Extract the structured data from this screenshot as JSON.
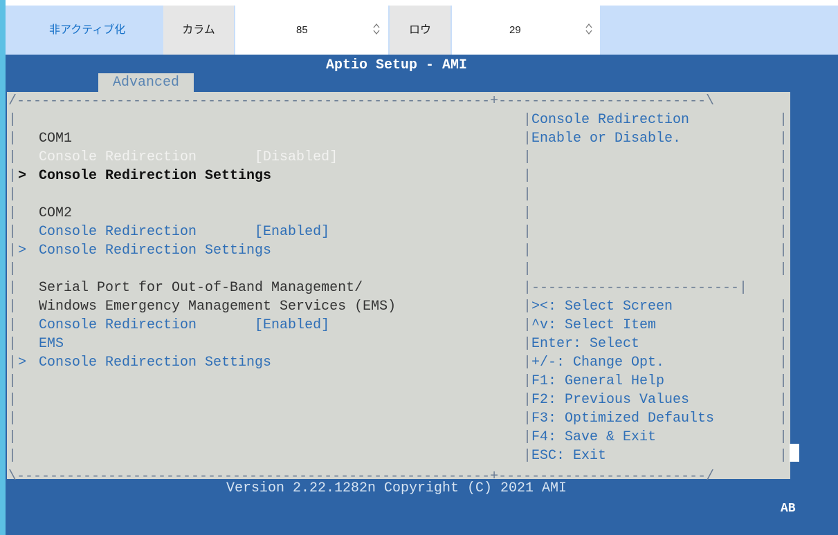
{
  "toolbar": {
    "inactive_label": "非アクティブ化",
    "columns_label": "カラム",
    "columns_value": "85",
    "rows_label": "ロウ",
    "rows_value": "29"
  },
  "terminal": {
    "title": "Aptio Setup - AMI",
    "tab": "Advanced",
    "lines": {
      "com1": "COM1",
      "com1_redirection": "Console Redirection       [Disabled]",
      "com1_settings": "Console Redirection Settings",
      "com2": "COM2",
      "com2_redirection": "Console Redirection       [Enabled]",
      "com2_settings": "Console Redirection Settings",
      "serial_port": "Serial Port for Out-of-Band Management/",
      "windows_ems": "Windows Emergency Management Services (EMS)",
      "ems_redirection": "Console Redirection       [Enabled]",
      "ems_label": "EMS",
      "ems_settings": "Console Redirection Settings"
    },
    "help": {
      "line1": "Console Redirection",
      "line2": "Enable or Disable."
    },
    "keys": [
      "><: Select Screen",
      "^v: Select Item",
      "Enter: Select",
      "+/-: Change Opt.",
      "F1: General Help",
      "F2: Previous Values",
      "F3: Optimized Defaults",
      "F4: Save & Exit",
      "ESC: Exit"
    ],
    "footer": "Version 2.22.1282n Copyright (C) 2021 AMI",
    "corner": "AB"
  }
}
